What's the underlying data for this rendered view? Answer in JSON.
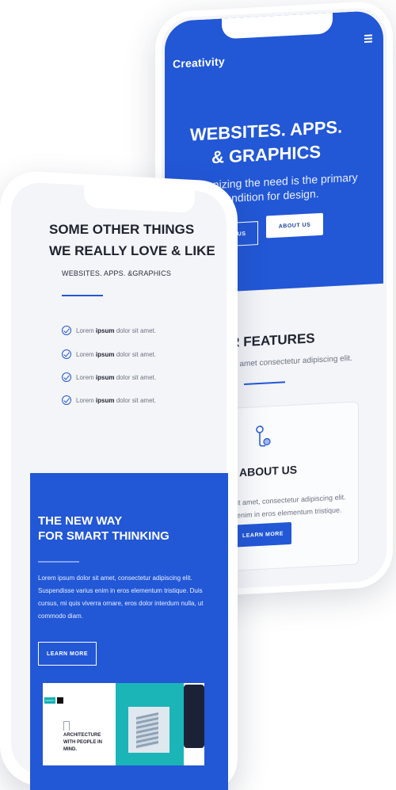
{
  "back_phone": {
    "brand": "Creativity",
    "hero": {
      "title_line1": "WEBSITES. APPS.",
      "title_line2": "& GRAPHICS",
      "subtitle": "Recognizing the need is the primary condition for design.",
      "btn_contact": "ACT US",
      "btn_about": "ABOUT US"
    },
    "features": {
      "title": "UR FEATURES",
      "subtitle": "or sit amet consectetur adipiscing elit."
    },
    "about_card": {
      "title": "ABOUT US",
      "text": "lor sit amet, consectetur adipiscing elit. rius enim in eros elementum tristique.",
      "btn": "LEARN MORE"
    }
  },
  "front_phone": {
    "title_line1": "SOME OTHER THINGS",
    "title_line2": "WE REALLY LOVE & LIKE",
    "subtitle": "WEBSITES. APPS. &GRAPHICS",
    "checklist": [
      {
        "pre": "Lorem",
        "bold": "ipsum",
        "post": "dolor sit amet."
      },
      {
        "pre": "Lorem",
        "bold": "ipsum",
        "post": "dolor sit amet."
      },
      {
        "pre": "Lorem",
        "bold": "ipsum",
        "post": "dolor sit amet."
      },
      {
        "pre": "Lorem",
        "bold": "ipsum",
        "post": "dolor sit amet."
      }
    ],
    "blue_section": {
      "title_line1": "THE NEW WAY",
      "title_line2": "FOR SMART THINKING",
      "text": "Lorem ipsum dolor sit amet, consectetur adipiscing elit. Suspendisse varius enim in eros elementum tristique. Duis cursus, mi quis viverra ornare, eros dolor interdum nulla, ut commodo diam.",
      "btn": "LEARN MORE"
    },
    "mockup": {
      "tag": "LEGACY",
      "title": "ARCHITECTURE WITH PEOPLE IN MIND."
    }
  },
  "colors": {
    "primary_blue": "#2257d6",
    "teal": "#1bb5b7",
    "dark_text": "#1f2330"
  }
}
